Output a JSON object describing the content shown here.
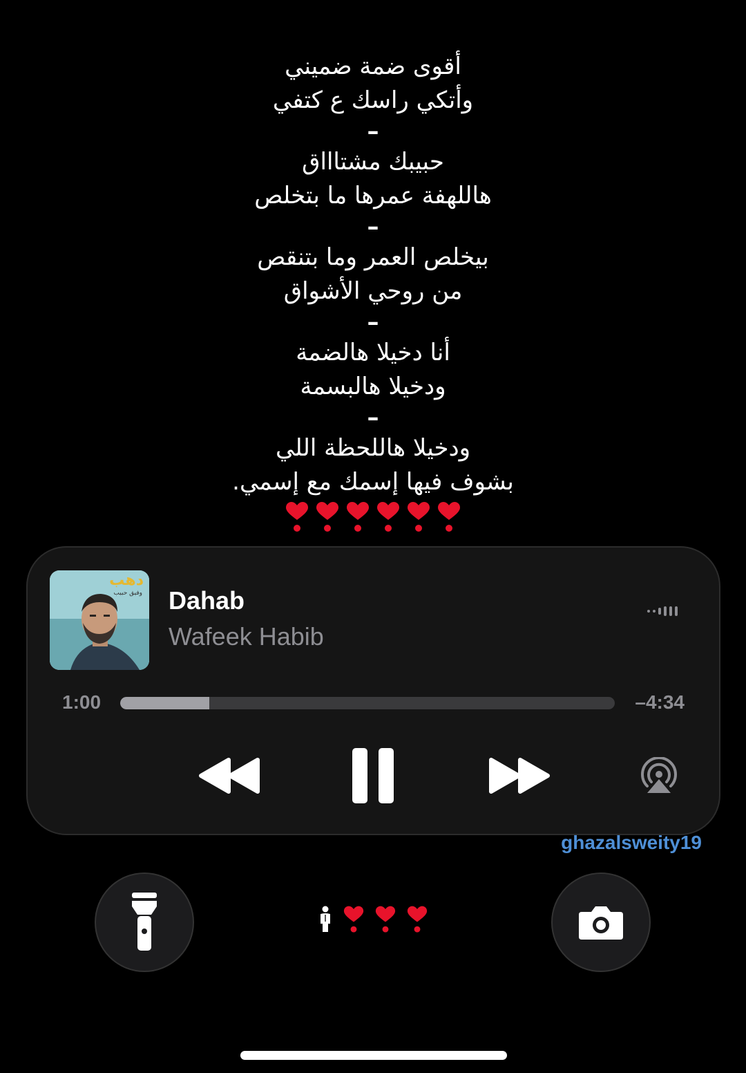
{
  "lyrics": [
    {
      "type": "line",
      "text": "أقوى ضمة ضميني"
    },
    {
      "type": "line",
      "text": "وأتكي راسك ع كتفي"
    },
    {
      "type": "sep",
      "text": "–"
    },
    {
      "type": "line",
      "text": "حبيبك مشتاااق"
    },
    {
      "type": "line",
      "text": "هاللهفة عمرها ما بتخلص"
    },
    {
      "type": "sep",
      "text": "–"
    },
    {
      "type": "line",
      "text": "بيخلص العمر وما بتنقص"
    },
    {
      "type": "line",
      "text": "من روحي الأشواق"
    },
    {
      "type": "sep",
      "text": "–"
    },
    {
      "type": "line",
      "text": "أنا دخيلا هالضمة"
    },
    {
      "type": "line",
      "text": "ودخيلا هالبسمة"
    },
    {
      "type": "sep",
      "text": "–"
    },
    {
      "type": "line",
      "text": "ودخيلا هاللحظة اللي"
    },
    {
      "type": "line",
      "text": "بشوف فيها إسمك مع إسمي."
    }
  ],
  "lyrics_hearts_count": 6,
  "player": {
    "artwork_text": "دهب",
    "artwork_subtext": "وفيق حبيب",
    "title": "Dahab",
    "artist": "Wafeek Habib",
    "elapsed": "1:00",
    "remaining": "–4:34",
    "progress_fraction": 0.18
  },
  "watermark": "ghazalsweity19",
  "status_hearts_count": 3,
  "colors": {
    "heart": "#e8132b",
    "accent_link": "#4e8fd6",
    "card_bg": "#151515"
  },
  "icons": {
    "rewind": "rewind-icon",
    "pause": "pause-icon",
    "forward": "forward-icon",
    "airplay": "airplay-icon",
    "flashlight": "flashlight-icon",
    "camera": "camera-icon",
    "person": "person-icon"
  }
}
